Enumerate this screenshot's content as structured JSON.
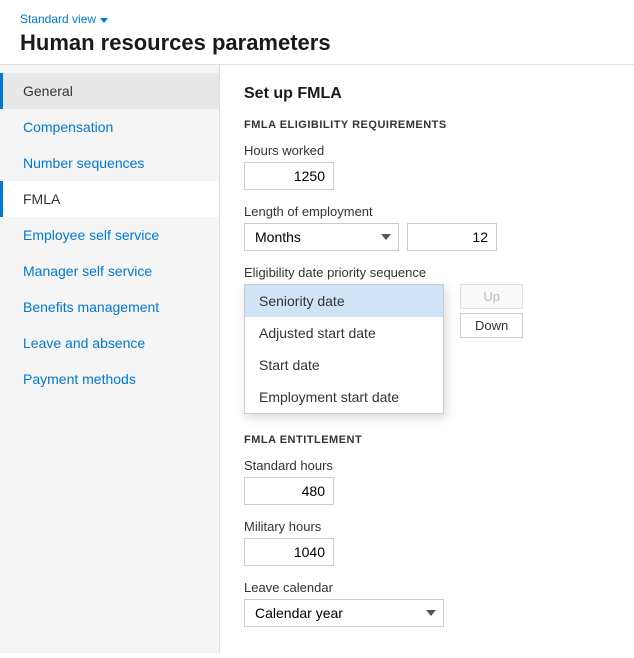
{
  "header": {
    "standard_view_label": "Standard view",
    "page_title": "Human resources parameters"
  },
  "sidebar": {
    "items": [
      {
        "id": "general",
        "label": "General",
        "active": true
      },
      {
        "id": "compensation",
        "label": "Compensation",
        "active": false
      },
      {
        "id": "number-sequences",
        "label": "Number sequences",
        "active": false
      },
      {
        "id": "fmla",
        "label": "FMLA",
        "active": false,
        "selected": true
      },
      {
        "id": "employee-self-service",
        "label": "Employee self service",
        "active": false
      },
      {
        "id": "manager-self-service",
        "label": "Manager self service",
        "active": false
      },
      {
        "id": "benefits-management",
        "label": "Benefits management",
        "active": false
      },
      {
        "id": "leave-and-absence",
        "label": "Leave and absence",
        "active": false
      },
      {
        "id": "payment-methods",
        "label": "Payment methods",
        "active": false
      }
    ]
  },
  "main": {
    "section_title": "Set up FMLA",
    "eligibility": {
      "subsection_label": "FMLA ELIGIBILITY REQUIREMENTS",
      "hours_worked_label": "Hours worked",
      "hours_worked_value": "1250",
      "length_of_employment_label": "Length of employment",
      "length_of_employment_unit": "Months",
      "length_of_employment_value": "12",
      "eligibility_date_label": "Eligibility date priority sequence",
      "dropdown_options": [
        {
          "id": "seniority-date",
          "label": "Seniority date",
          "highlighted": true
        },
        {
          "id": "adjusted-start-date",
          "label": "Adjusted start date",
          "highlighted": false
        },
        {
          "id": "start-date",
          "label": "Start date",
          "highlighted": false
        },
        {
          "id": "employment-start-date",
          "label": "Employment start date",
          "highlighted": false
        }
      ],
      "up_button_label": "Up",
      "down_button_label": "Down"
    },
    "entitlement": {
      "subsection_label": "FMLA ENTITLEMENT",
      "standard_hours_label": "Standard hours",
      "standard_hours_value": "480",
      "military_hours_label": "Military hours",
      "military_hours_value": "1040",
      "leave_calendar_label": "Leave calendar",
      "leave_calendar_value": "Calendar year"
    }
  }
}
